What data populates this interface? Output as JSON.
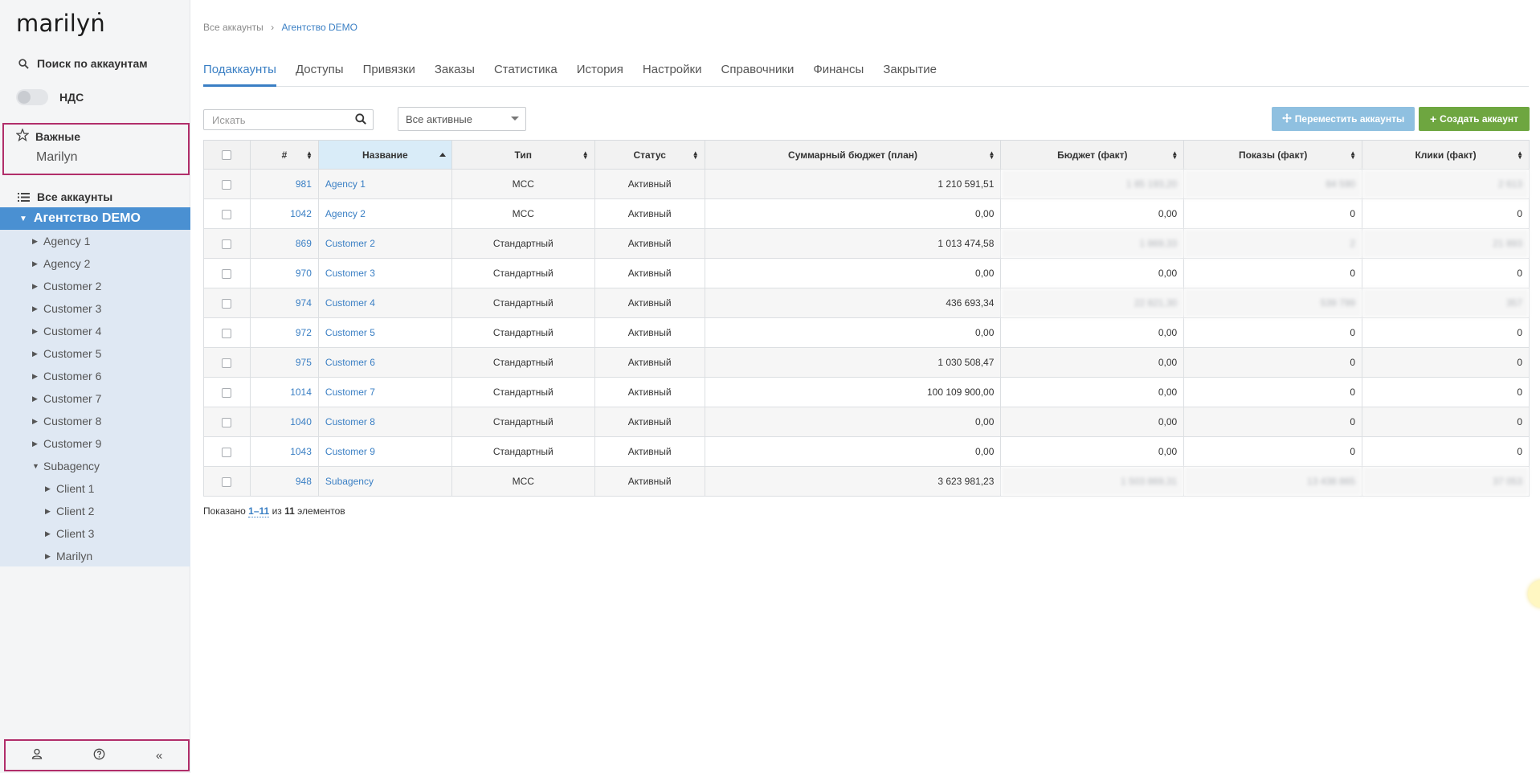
{
  "logo": "marilyn",
  "sidebar": {
    "search_label": "Поиск по аккаунтам",
    "vat_label": "НДС",
    "favorites_title": "Важные",
    "favorites": [
      "Marilyn"
    ],
    "all_accounts_label": "Все аккаунты",
    "selected_account": "Агентство DEMO",
    "tree": [
      {
        "label": "Agency 1",
        "expanded": false
      },
      {
        "label": "Agency 2",
        "expanded": false
      },
      {
        "label": "Customer 2",
        "expanded": false
      },
      {
        "label": "Customer 3",
        "expanded": false
      },
      {
        "label": "Customer 4",
        "expanded": false
      },
      {
        "label": "Customer 5",
        "expanded": false
      },
      {
        "label": "Customer 6",
        "expanded": false
      },
      {
        "label": "Customer 7",
        "expanded": false
      },
      {
        "label": "Customer 8",
        "expanded": false
      },
      {
        "label": "Customer 9",
        "expanded": false
      },
      {
        "label": "Subagency",
        "expanded": true
      },
      {
        "label": "Client 1",
        "expanded": false
      },
      {
        "label": "Client 2",
        "expanded": false
      },
      {
        "label": "Client 3",
        "expanded": false
      },
      {
        "label": "Marilyn",
        "expanded": false
      }
    ],
    "bottom_icons": [
      "user-icon",
      "help-icon",
      "collapse-icon"
    ]
  },
  "breadcrumb": {
    "root": "Все аккаунты",
    "separator": "›",
    "current": "Агентство DEMO"
  },
  "tabs": [
    "Подаккаунты",
    "Доступы",
    "Привязки",
    "Заказы",
    "Статистика",
    "История",
    "Настройки",
    "Справочники",
    "Финансы",
    "Закрытие"
  ],
  "active_tab": "Подаккаунты",
  "search": {
    "placeholder": "Искать",
    "value": ""
  },
  "filter": {
    "selected": "Все активные"
  },
  "buttons": {
    "move": "Переместить аккаунты",
    "create": "Создать аккаунт"
  },
  "colors": {
    "accent": "#3a7fc4",
    "selected": "#4a90d2",
    "create": "#6ea640",
    "move": "#8fc0e0",
    "frame": "#b12e6a"
  },
  "table": {
    "columns": [
      "#",
      "Название",
      "Тип",
      "Статус",
      "Суммарный бюджет (план)",
      "Бюджет (факт)",
      "Показы (факт)",
      "Клики (факт)"
    ],
    "sorted_column": "Название",
    "rows": [
      {
        "id": "981",
        "name": "Agency 1",
        "type": "MCC",
        "status": "Активный",
        "plan": "1 210 591,51",
        "budget": "1 85 193,20",
        "shows": "84 590",
        "clicks": "2 613",
        "blur": true
      },
      {
        "id": "1042",
        "name": "Agency 2",
        "type": "MCC",
        "status": "Активный",
        "plan": "0,00",
        "budget": "0,00",
        "shows": "0",
        "clicks": "0",
        "blur": false
      },
      {
        "id": "869",
        "name": "Customer 2",
        "type": "Стандартный",
        "status": "Активный",
        "plan": "1 013 474,58",
        "budget": "1 869,33",
        "shows": "2",
        "clicks": "21 893",
        "blur": true
      },
      {
        "id": "970",
        "name": "Customer 3",
        "type": "Стандартный",
        "status": "Активный",
        "plan": "0,00",
        "budget": "0,00",
        "shows": "0",
        "clicks": "0",
        "blur": false
      },
      {
        "id": "974",
        "name": "Customer 4",
        "type": "Стандартный",
        "status": "Активный",
        "plan": "436 693,34",
        "budget": "22 821,30",
        "shows": "539 799",
        "clicks": "357",
        "blur": true
      },
      {
        "id": "972",
        "name": "Customer 5",
        "type": "Стандартный",
        "status": "Активный",
        "plan": "0,00",
        "budget": "0,00",
        "shows": "0",
        "clicks": "0",
        "blur": false
      },
      {
        "id": "975",
        "name": "Customer 6",
        "type": "Стандартный",
        "status": "Активный",
        "plan": "1 030 508,47",
        "budget": "0,00",
        "shows": "0",
        "clicks": "0",
        "blur": false
      },
      {
        "id": "1014",
        "name": "Customer 7",
        "type": "Стандартный",
        "status": "Активный",
        "plan": "100 109 900,00",
        "budget": "0,00",
        "shows": "0",
        "clicks": "0",
        "blur": false
      },
      {
        "id": "1040",
        "name": "Customer 8",
        "type": "Стандартный",
        "status": "Активный",
        "plan": "0,00",
        "budget": "0,00",
        "shows": "0",
        "clicks": "0",
        "blur": false
      },
      {
        "id": "1043",
        "name": "Customer 9",
        "type": "Стандартный",
        "status": "Активный",
        "plan": "0,00",
        "budget": "0,00",
        "shows": "0",
        "clicks": "0",
        "blur": false
      },
      {
        "id": "948",
        "name": "Subagency",
        "type": "MCC",
        "status": "Активный",
        "plan": "3 623 981,23",
        "budget": "1 503 869,31",
        "shows": "13 438 865",
        "clicks": "37 053",
        "blur": true
      }
    ]
  },
  "pagination": {
    "prefix": "Показано",
    "range": "1–11",
    "of": "из",
    "total": "11",
    "suffix": "элементов"
  }
}
